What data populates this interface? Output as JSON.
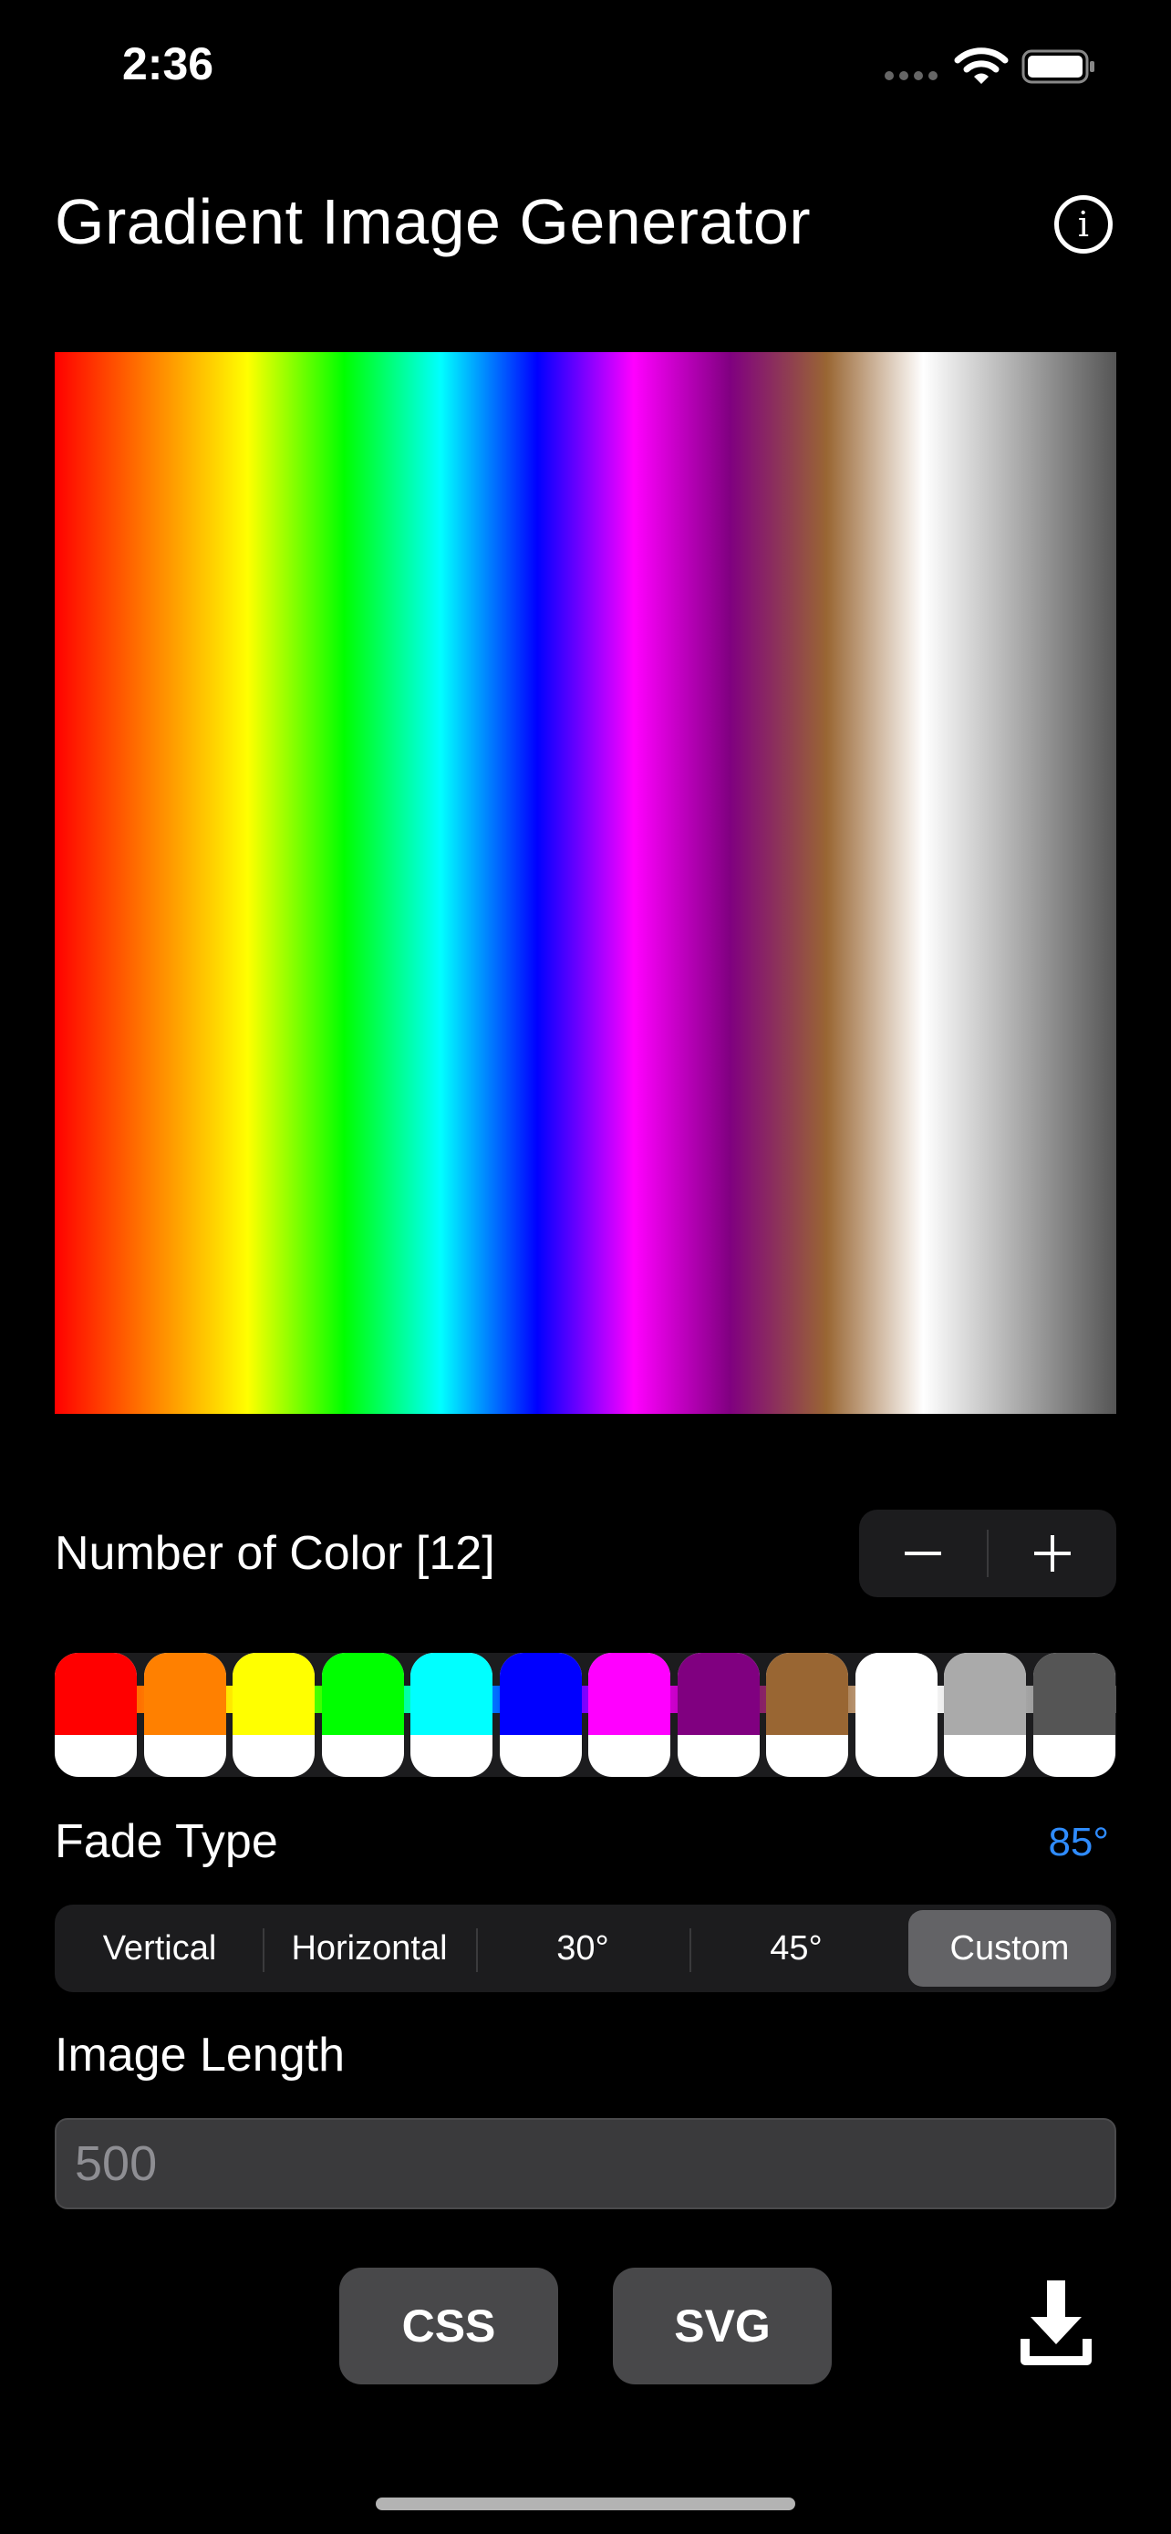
{
  "status": {
    "time": "2:36"
  },
  "header": {
    "title": "Gradient Image Generator",
    "info_icon": "info-circle-icon"
  },
  "preview": {
    "angle_deg": 85,
    "colors": [
      "#ff0000",
      "#ff8000",
      "#ffff00",
      "#00ff00",
      "#00ffff",
      "#0000ff",
      "#ff00ff",
      "#800080",
      "#996633",
      "#ffffff",
      "#aaaaaa",
      "#555555"
    ]
  },
  "color_count": {
    "label": "Number of Color [12]",
    "minus": "−",
    "plus": "+"
  },
  "swatches": [
    "#ff0000",
    "#ff8000",
    "#ffff00",
    "#00ff00",
    "#00ffff",
    "#0000ff",
    "#ff00ff",
    "#800080",
    "#996633",
    "#ffffff",
    "#aaaaaa",
    "#555555"
  ],
  "fade": {
    "label": "Fade Type",
    "angle": "85°",
    "options": [
      "Vertical",
      "Horizontal",
      "30°",
      "45°",
      "Custom"
    ],
    "selected": "Custom"
  },
  "image_length": {
    "label": "Image Length",
    "placeholder": "500",
    "value": ""
  },
  "actions": {
    "css": "CSS",
    "svg": "SVG",
    "download_icon": "download-icon"
  },
  "theme": {
    "accent": "#2f8cff",
    "background": "#000000",
    "control_bg": "#1c1c1e",
    "selected_bg": "#636366"
  }
}
